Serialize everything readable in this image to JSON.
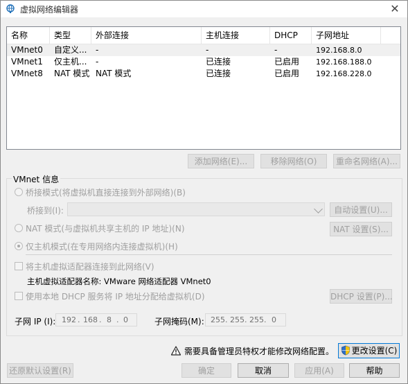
{
  "window": {
    "title": "虚拟网络编辑器",
    "close": "✕"
  },
  "list": {
    "columns": [
      "名称",
      "类型",
      "外部连接",
      "主机连接",
      "DHCP",
      "子网地址"
    ],
    "rows": [
      [
        "VMnet0",
        "自定义...",
        "-",
        "-",
        "-",
        "192.168.8.0"
      ],
      [
        "VMnet1",
        "仅主机...",
        "-",
        "已连接",
        "已启用",
        "192.168.188.0"
      ],
      [
        "VMnet8",
        "NAT 模式",
        "NAT 模式",
        "已连接",
        "已启用",
        "192.168.228.0"
      ]
    ]
  },
  "list_buttons": {
    "add": "添加网络(E)...",
    "remove": "移除网络(O)",
    "rename": "重命名网络(A)..."
  },
  "vmnet": {
    "group_label": "VMnet 信息",
    "bridged": "桥接模式(将虚拟机直接连接到外部网络)(B)",
    "bridge_to_label": "桥接到(I):",
    "bridge_to_value": "",
    "auto_settings": "自动设置(U)...",
    "nat": "NAT 模式(与虚拟机共享主机的 IP 地址)(N)",
    "nat_settings": "NAT 设置(S)...",
    "host_only": "仅主机模式(在专用网络内连接虚拟机)(H)",
    "connect_adapter": "将主机虚拟适配器连接到此网络(V)",
    "adapter_name": "主机虚拟适配器名称: VMware 网络适配器 VMnet0",
    "use_dhcp": "使用本地 DHCP 服务将 IP 地址分配给虚拟机(D)",
    "dhcp_settings": "DHCP 设置(P)...",
    "subnet_ip_label": "子网 IP (I):",
    "subnet_ip": [
      "192",
      "168",
      "8",
      "0"
    ],
    "subnet_mask_label": "子网掩码(M):",
    "subnet_mask": [
      "255",
      "255",
      "255",
      "0"
    ]
  },
  "admin": {
    "notice": "需要具备管理员特权才能修改网络配置。",
    "change_settings": "更改设置(C)"
  },
  "footer": {
    "restore": "还原默认设置(R)",
    "ok": "确定",
    "cancel": "取消",
    "apply": "应用(A)",
    "help": "帮助"
  }
}
